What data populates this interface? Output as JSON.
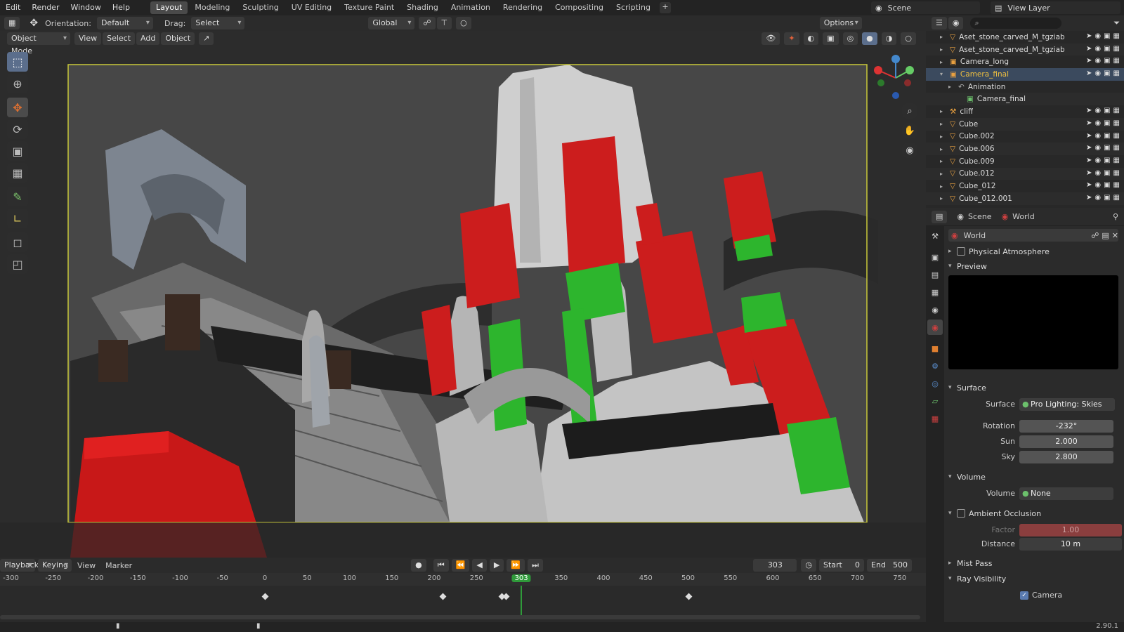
{
  "menu": [
    "Edit",
    "Render",
    "Window",
    "Help"
  ],
  "workspaces": [
    "Layout",
    "Modeling",
    "Sculpting",
    "UV Editing",
    "Texture Paint",
    "Shading",
    "Animation",
    "Rendering",
    "Compositing",
    "Scripting"
  ],
  "active_workspace": "Layout",
  "scene_name": "Scene",
  "view_layer": "View Layer",
  "header": {
    "orientation_label": "Orientation:",
    "orientation_value": "Default",
    "drag_label": "Drag:",
    "drag_value": "Select Box",
    "transform_orientation": "Global",
    "options": "Options"
  },
  "viewport_header": {
    "mode": "Object Mode",
    "view": "View",
    "select": "Select",
    "add": "Add",
    "object": "Object"
  },
  "outliner": {
    "rows": [
      {
        "name": "Aset_stone_carved_M_tgziabifa",
        "type": "mesh",
        "indent": 1
      },
      {
        "name": "Aset_stone_carved_M_tgziabifa",
        "type": "mesh",
        "indent": 1
      },
      {
        "name": "Camera_long",
        "type": "camera",
        "indent": 1
      },
      {
        "name": "Camera_final",
        "type": "camera",
        "indent": 1,
        "selected": true
      },
      {
        "name": "Animation",
        "type": "action",
        "indent": 2
      },
      {
        "name": "Camera_final",
        "type": "camera-data",
        "indent": 3
      },
      {
        "name": "cliff",
        "type": "armature",
        "indent": 1
      },
      {
        "name": "Cube",
        "type": "mesh",
        "indent": 1
      },
      {
        "name": "Cube.002",
        "type": "mesh",
        "indent": 1
      },
      {
        "name": "Cube.006",
        "type": "mesh",
        "indent": 1
      },
      {
        "name": "Cube.009",
        "type": "mesh",
        "indent": 1
      },
      {
        "name": "Cube.012",
        "type": "mesh",
        "indent": 1
      },
      {
        "name": "Cube_012",
        "type": "mesh",
        "indent": 1
      },
      {
        "name": "Cube_012.001",
        "type": "mesh",
        "indent": 1
      }
    ]
  },
  "properties": {
    "breadcrumb_scene": "Scene",
    "breadcrumb_world": "World",
    "world_name": "World",
    "physical_atmosphere": "Physical Atmosphere",
    "preview": "Preview",
    "surface_section": "Surface",
    "surface_label": "Surface",
    "surface_value": "Pro Lighting: Skies",
    "rotation_label": "Rotation",
    "rotation_value": "-232°",
    "sun_label": "Sun",
    "sun_value": "2.000",
    "sky_label": "Sky",
    "sky_value": "2.800",
    "volume_section": "Volume",
    "volume_label": "Volume",
    "volume_value": "None",
    "ao_section": "Ambient Occlusion",
    "factor_label": "Factor",
    "factor_value": "1.00",
    "distance_label": "Distance",
    "distance_value": "10 m",
    "mist_pass": "Mist Pass",
    "ray_visibility": "Ray Visibility",
    "camera_label": "Camera"
  },
  "timeline": {
    "playback": "Playback",
    "keying": "Keying",
    "view": "View",
    "marker": "Marker",
    "current_frame": "303",
    "start_label": "Start",
    "start_value": "0",
    "end_label": "End",
    "end_value": "500",
    "ticks": [
      "-300",
      "-250",
      "-200",
      "-150",
      "-100",
      "-50",
      "0",
      "50",
      "100",
      "150",
      "200",
      "250",
      "303",
      "350",
      "400",
      "450",
      "500",
      "550",
      "600",
      "650",
      "700",
      "750"
    ],
    "keyframes": [
      0,
      210,
      280,
      285,
      500
    ]
  },
  "version": "2.90.1",
  "colors": {
    "accent": "#3f6fb3",
    "active_frame": "#2f9a3a",
    "selected_outliner": "#f0c040",
    "red_mark": "#d41e1e",
    "green_mark": "#2fb52f"
  }
}
